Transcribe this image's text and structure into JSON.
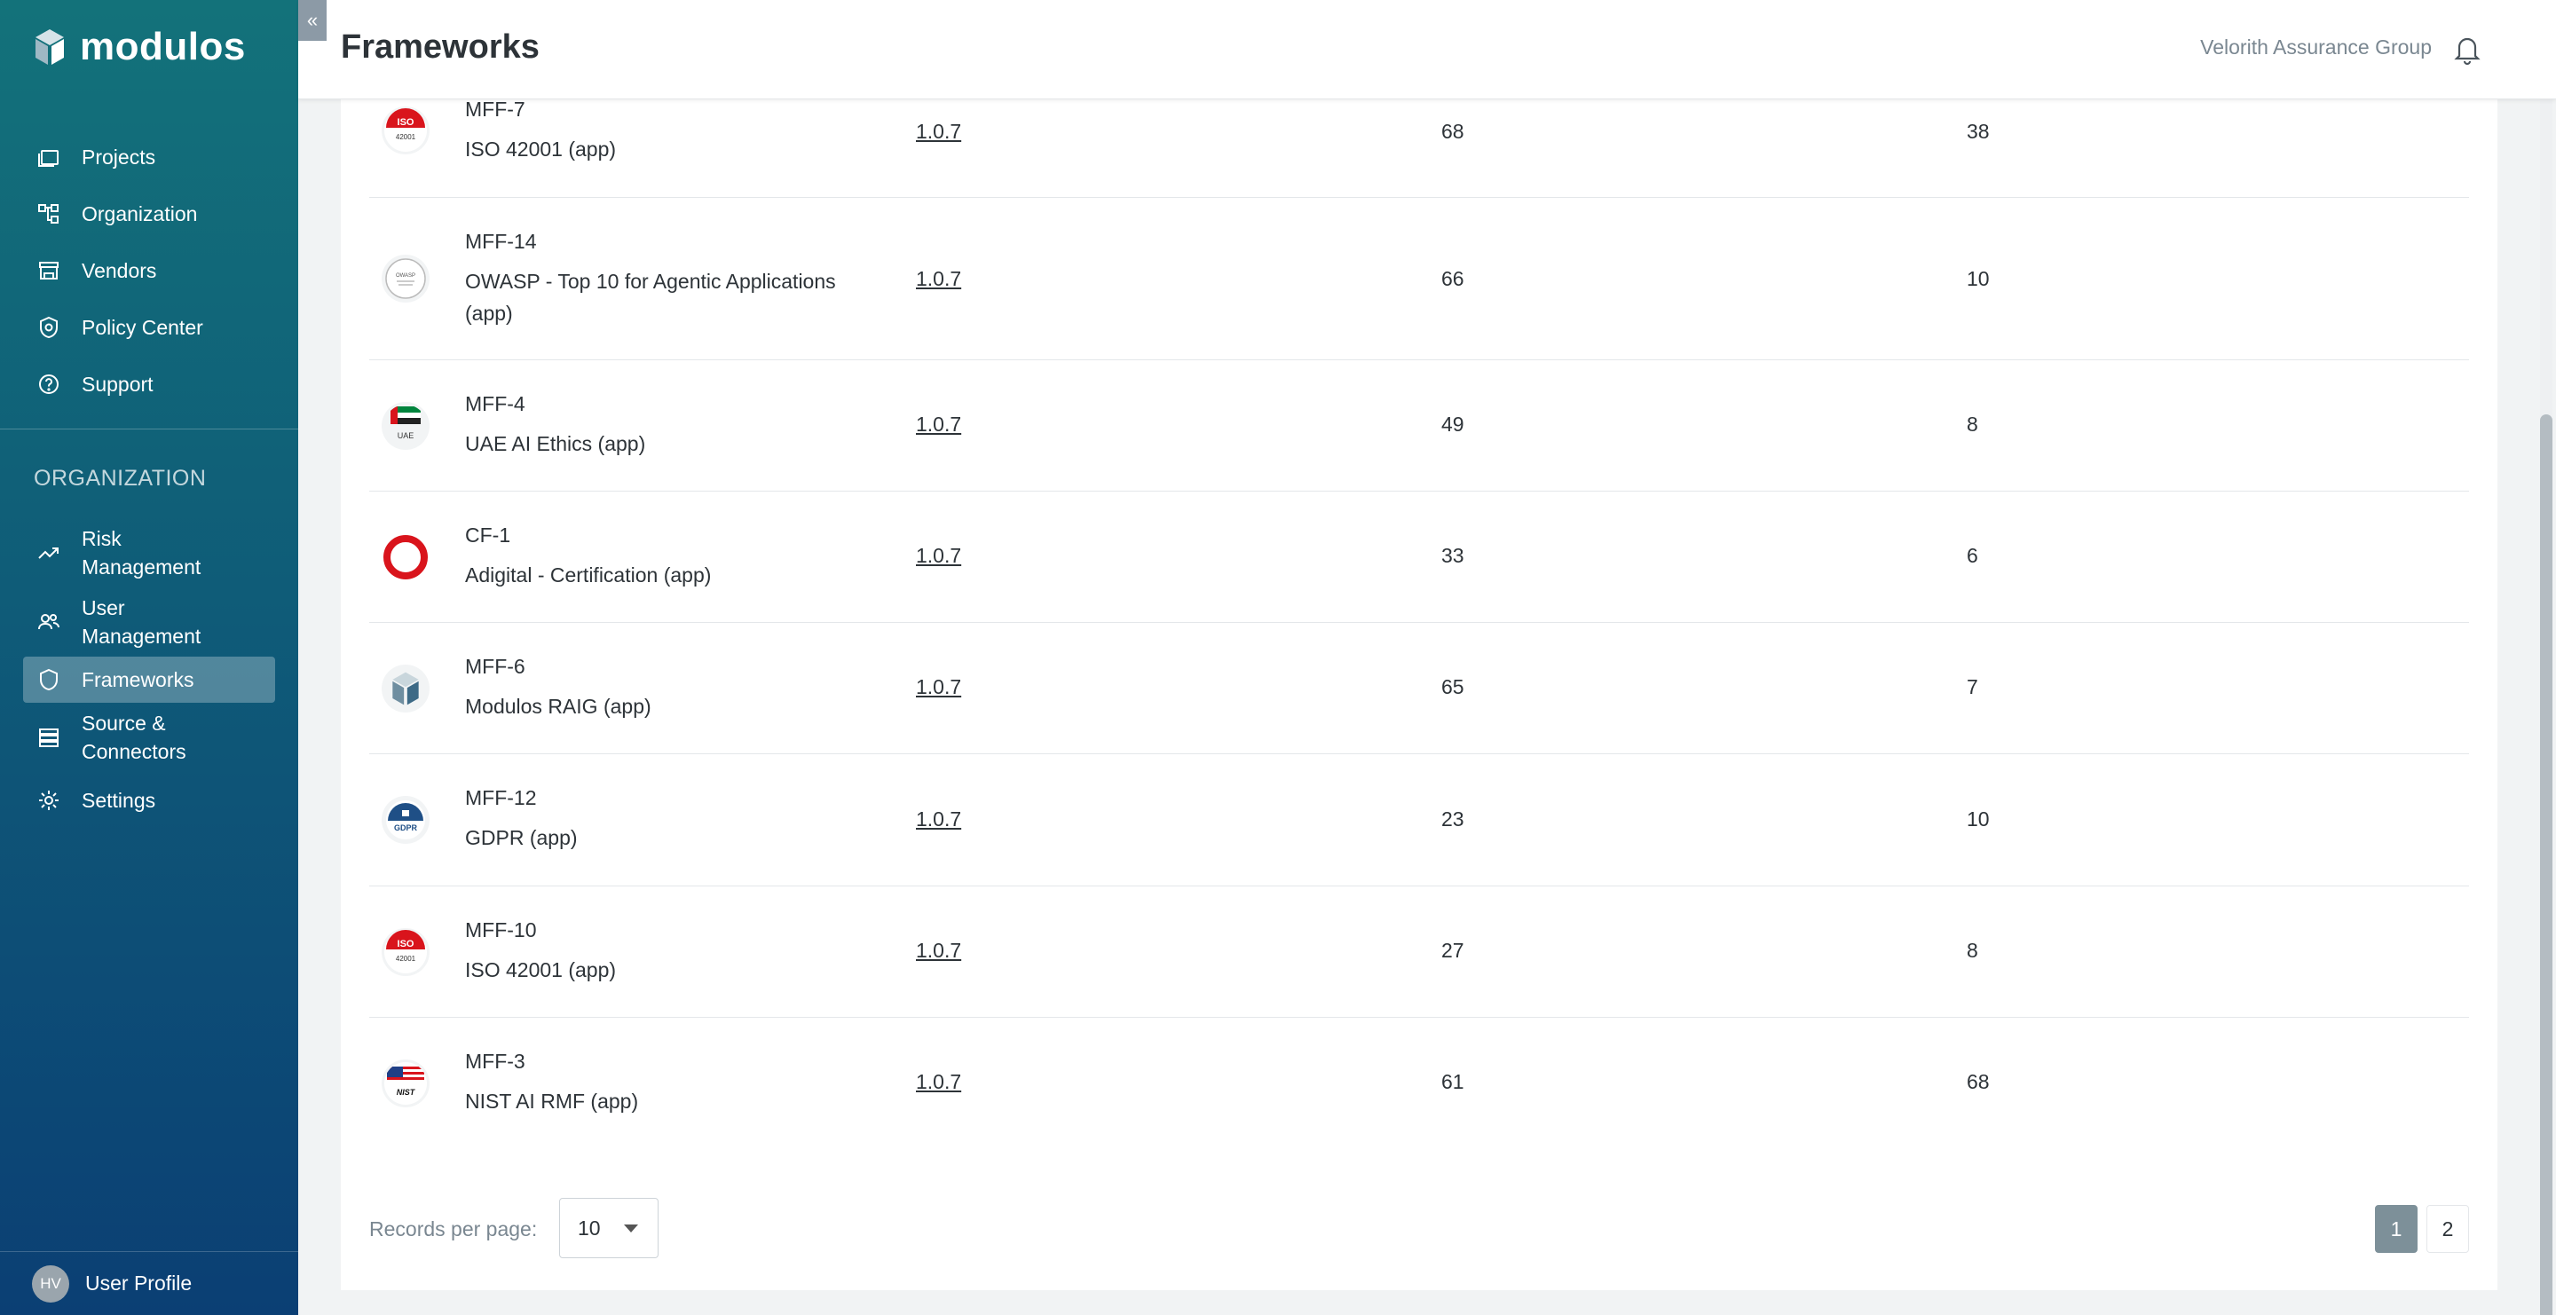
{
  "app": {
    "brand": "modulos",
    "page_title": "Frameworks",
    "org_name": "Velorith Assurance Group"
  },
  "sidebar": {
    "main": [
      {
        "label": "Projects",
        "icon": "folder-icon"
      },
      {
        "label": "Organization",
        "icon": "org-tree-icon"
      },
      {
        "label": "Vendors",
        "icon": "store-icon"
      },
      {
        "label": "Policy Center",
        "icon": "shield-gear-icon"
      },
      {
        "label": "Support",
        "icon": "help-circle-icon"
      }
    ],
    "section_label": "ORGANIZATION",
    "org": [
      {
        "label": "Risk Management",
        "icon": "trend-icon"
      },
      {
        "label": "User Management",
        "icon": "users-icon"
      },
      {
        "label": "Frameworks",
        "icon": "shield-icon",
        "active": true
      },
      {
        "label": "Source & Connectors",
        "icon": "database-icon"
      },
      {
        "label": "Settings",
        "icon": "gear-icon"
      }
    ],
    "profile": {
      "initials": "HV",
      "label": "User Profile"
    }
  },
  "frameworks": [
    {
      "code": "MFF-7",
      "name": "ISO 42001 (app)",
      "version": "1.0.7",
      "col3": "68",
      "col4": "38",
      "logo": "iso"
    },
    {
      "code": "MFF-14",
      "name": "OWASP - Top 10 for Agentic Applications (app)",
      "version": "1.0.7",
      "col3": "66",
      "col4": "10",
      "logo": "owasp"
    },
    {
      "code": "MFF-4",
      "name": "UAE AI Ethics (app)",
      "version": "1.0.7",
      "col3": "49",
      "col4": "8",
      "logo": "uae"
    },
    {
      "code": "CF-1",
      "name": "Adigital - Certification (app)",
      "version": "1.0.7",
      "col3": "33",
      "col4": "6",
      "logo": "ring"
    },
    {
      "code": "MFF-6",
      "name": "Modulos RAIG (app)",
      "version": "1.0.7",
      "col3": "65",
      "col4": "7",
      "logo": "modulos"
    },
    {
      "code": "MFF-12",
      "name": "GDPR (app)",
      "version": "1.0.7",
      "col3": "23",
      "col4": "10",
      "logo": "gdpr"
    },
    {
      "code": "MFF-10",
      "name": "ISO 42001 (app)",
      "version": "1.0.7",
      "col3": "27",
      "col4": "8",
      "logo": "iso"
    },
    {
      "code": "MFF-3",
      "name": "NIST AI RMF (app)",
      "version": "1.0.7",
      "col3": "61",
      "col4": "68",
      "logo": "nist"
    }
  ],
  "logo_text": {
    "iso_top": "ISO",
    "iso_bottom": "42001",
    "uae": "UAE",
    "gdpr": "GDPR",
    "nist": "NIST",
    "owasp": "OWASP"
  },
  "pagination": {
    "records_label": "Records per page:",
    "per_page": "10",
    "pages": [
      "1",
      "2"
    ],
    "current": "1"
  },
  "colors": {
    "accent": "#7d9099",
    "sidebar_top": "#13727a",
    "sidebar_bottom": "#0b3f74",
    "iso_red": "#d9141c"
  }
}
